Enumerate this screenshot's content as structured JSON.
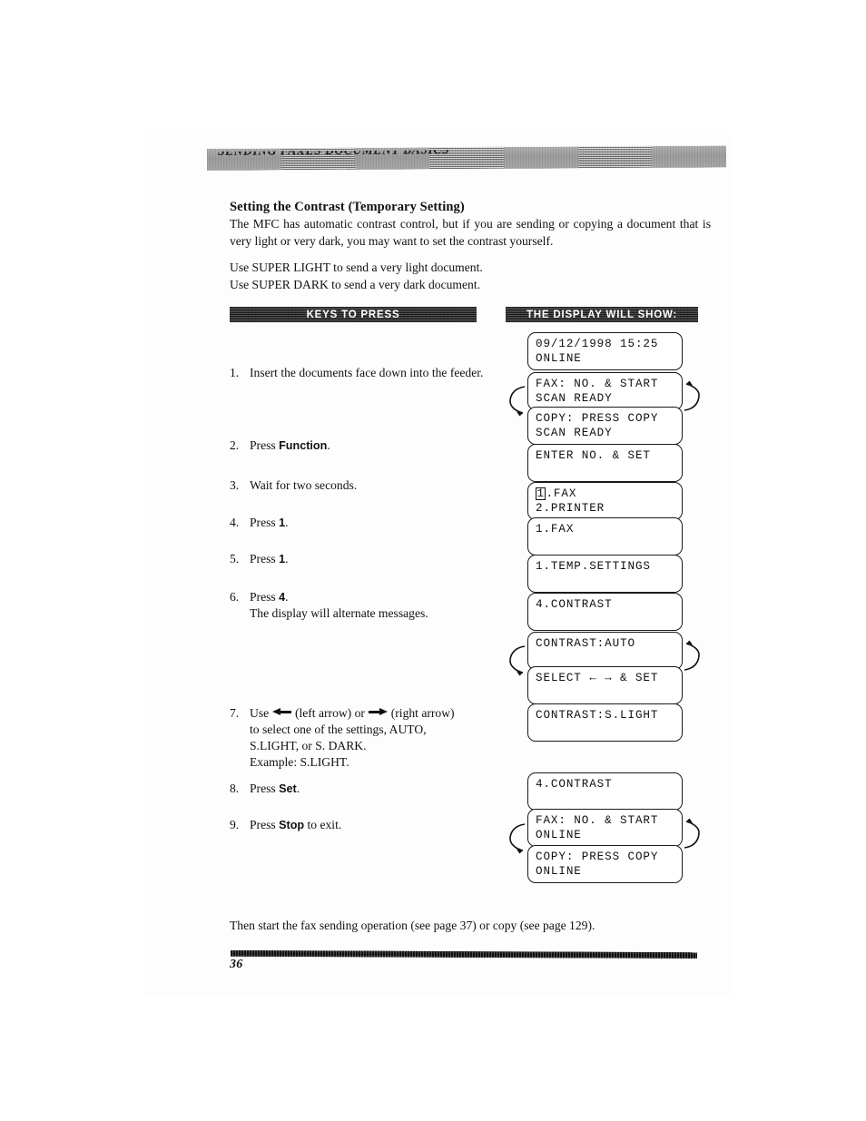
{
  "header": {
    "running_head": "SENDING FAXES   DOCUMENT BASICS"
  },
  "section": {
    "heading": "Setting the Contrast (Temporary Setting)",
    "intro": "The MFC has automatic contrast control, but if you are sending or copying a document that is very light or very dark, you may want to set the contrast yourself.",
    "usage_line_1": "Use SUPER LIGHT to send a very light document.",
    "usage_line_2": "Use SUPER DARK to send a very dark document."
  },
  "banners": {
    "keys_to_press": "KEYS TO PRESS",
    "display_will_show": "THE DISPLAY WILL SHOW:"
  },
  "steps": [
    {
      "num": "1.",
      "text": "Insert the documents face down into the feeder."
    },
    {
      "num": "2.",
      "pre": "Press ",
      "key": "Function",
      "post": "."
    },
    {
      "num": "3.",
      "text": "Wait for two seconds."
    },
    {
      "num": "4.",
      "pre": "Press ",
      "key": "1",
      "post": "."
    },
    {
      "num": "5.",
      "pre": "Press ",
      "key": "1",
      "post": "."
    },
    {
      "num": "6.",
      "pre": "Press ",
      "key": "4",
      "post": ".",
      "sub": "The display will alternate messages."
    },
    {
      "num": "7.",
      "part_a": "Use ",
      "part_b": " (left arrow) or ",
      "part_c": " (right arrow)",
      "line2": "to select one of the settings, AUTO,",
      "line3": "S.LIGHT, or S. DARK.",
      "line4": "Example: S.LIGHT."
    },
    {
      "num": "8.",
      "pre": "Press ",
      "key": "Set",
      "post": "."
    },
    {
      "num": "9.",
      "pre": "Press ",
      "key": "Stop",
      "post": " to exit."
    }
  ],
  "displays": [
    {
      "id": "d1",
      "line1": "09/12/1998 15:25",
      "line2": "ONLINE"
    },
    {
      "id": "d2",
      "line1": "FAX: NO. & START",
      "line2": "SCAN READY"
    },
    {
      "id": "d3",
      "line1": "COPY: PRESS COPY",
      "line2": "SCAN READY"
    },
    {
      "id": "d4",
      "line1": "ENTER NO. & SET",
      "line2": ""
    },
    {
      "id": "d5",
      "line1_cursor": "1",
      "line1_rest": ".FAX",
      "line2": "2.PRINTER"
    },
    {
      "id": "d6",
      "line1": "1.FAX",
      "line2": ""
    },
    {
      "id": "d7",
      "line1": "1.TEMP.SETTINGS",
      "line2": ""
    },
    {
      "id": "d8",
      "line1": "4.CONTRAST",
      "line2": ""
    },
    {
      "id": "d9",
      "line1": "CONTRAST:AUTO",
      "line2": ""
    },
    {
      "id": "d10",
      "line1": "SELECT ← → & SET",
      "line2": ""
    },
    {
      "id": "d11",
      "line1": "CONTRAST:S.LIGHT",
      "line2": ""
    },
    {
      "id": "d12",
      "line1": "4.CONTRAST",
      "line2": ""
    },
    {
      "id": "d13",
      "line1": "FAX: NO. & START",
      "line2": "ONLINE"
    },
    {
      "id": "d14",
      "line1": "COPY: PRESS COPY",
      "line2": "ONLINE"
    }
  ],
  "closing": {
    "text": "Then start the fax sending operation (see page 37) or copy (see page 129)."
  },
  "footer": {
    "page_number": "36"
  },
  "colors": {
    "ink": "#111111",
    "banner_dark": "#2c2c2c",
    "banner_text": "#ffffff",
    "paper": "#ffffff"
  }
}
